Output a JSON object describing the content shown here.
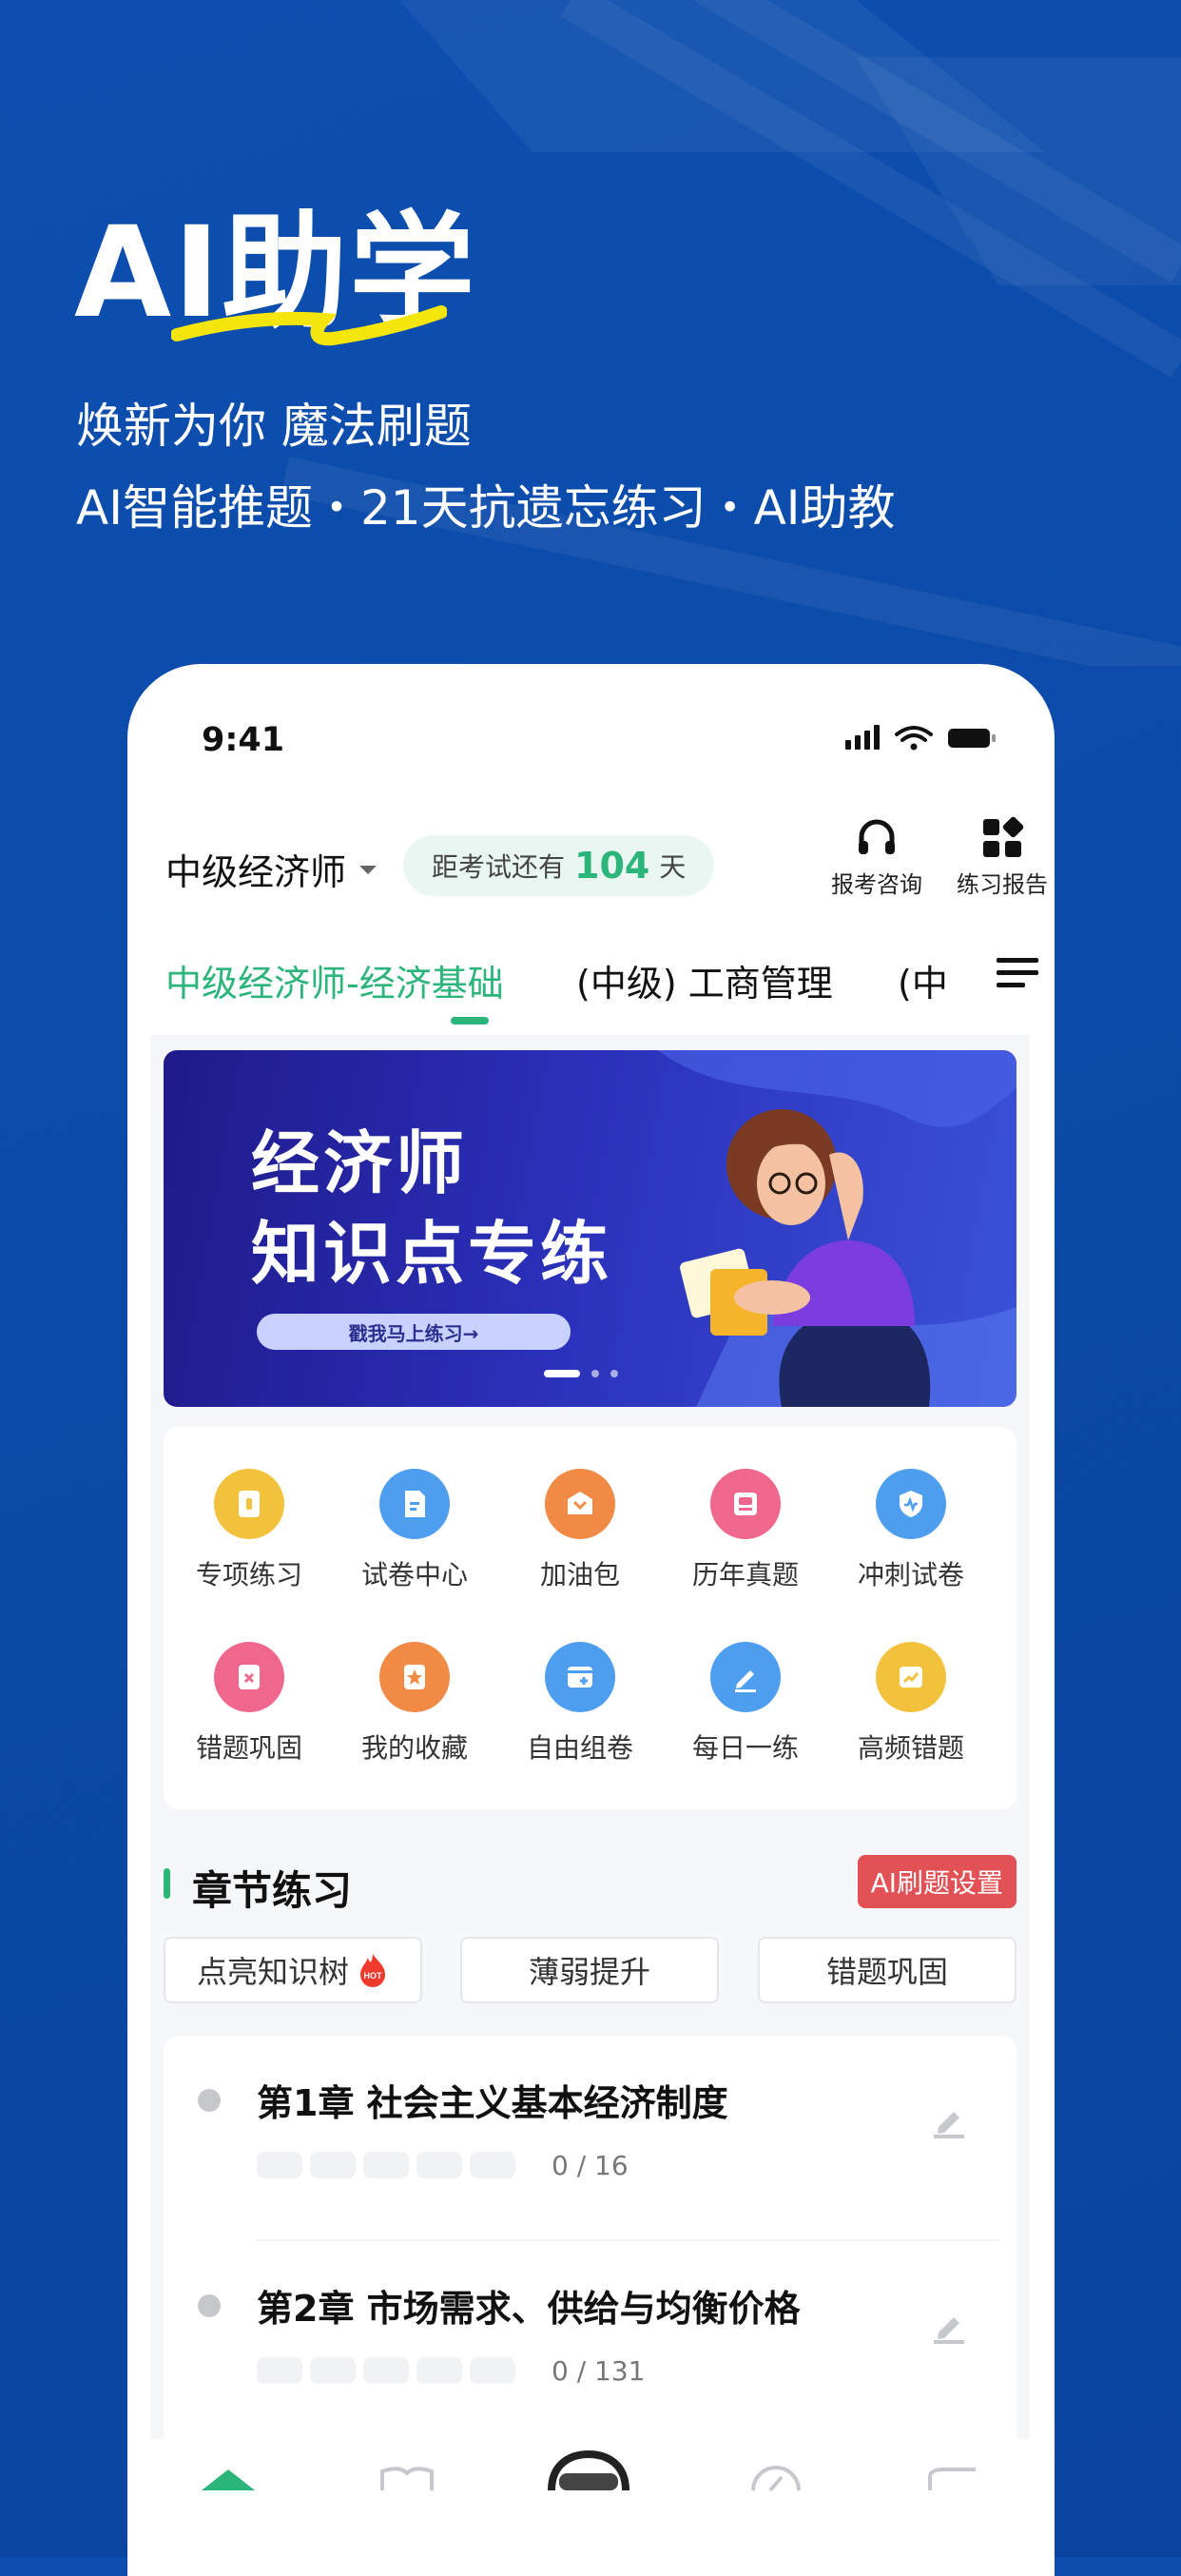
{
  "hero": {
    "title": "AI助学",
    "subtitle": "焕新为你 魔法刷题",
    "features": "AI智能推题・21天抗遗忘练习・AI助教"
  },
  "status_bar": {
    "time": "9:41"
  },
  "header": {
    "exam_name": "中级经济师",
    "countdown_prefix": "距考试还有",
    "countdown_days": "104",
    "countdown_suffix": "天",
    "consult_label": "报考咨询",
    "report_label": "练习报告"
  },
  "tabs": [
    {
      "label": "中级经济师-经济基础",
      "active": true
    },
    {
      "label": "(中级) 工商管理",
      "active": false
    },
    {
      "label": "(中",
      "active": false
    }
  ],
  "banner": {
    "line1": "经济师",
    "line2": "知识点专练",
    "cta": "戳我马上练习→",
    "page_count": 3,
    "current_page": 1
  },
  "features_grid": [
    {
      "label": "专项练习",
      "icon": "practice-icon",
      "color": "#f3c23d"
    },
    {
      "label": "试卷中心",
      "icon": "paper-icon",
      "color": "#4e9ef0"
    },
    {
      "label": "加油包",
      "icon": "gift-icon",
      "color": "#f08a45"
    },
    {
      "label": "历年真题",
      "icon": "history-icon",
      "color": "#f0678e"
    },
    {
      "label": "冲刺试卷",
      "icon": "shield-icon",
      "color": "#4e9ef0"
    },
    {
      "label": "错题巩固",
      "icon": "wrong-icon",
      "color": "#f0678e"
    },
    {
      "label": "我的收藏",
      "icon": "star-icon",
      "color": "#f08a45"
    },
    {
      "label": "自由组卷",
      "icon": "compose-icon",
      "color": "#4e9ef0"
    },
    {
      "label": "每日一练",
      "icon": "pencil-icon",
      "color": "#4e9ef0"
    },
    {
      "label": "高频错题",
      "icon": "trend-icon",
      "color": "#f3c23d"
    }
  ],
  "section": {
    "title": "章节练习",
    "ai_button": "AI刷题设置"
  },
  "filters": [
    {
      "label": "点亮知识树",
      "hot": true,
      "hot_text": "HOT"
    },
    {
      "label": "薄弱提升",
      "hot": false
    },
    {
      "label": "错题巩固",
      "hot": false
    }
  ],
  "chapters": [
    {
      "title": "第1章 社会主义基本经济制度",
      "progress": "0 / 16"
    },
    {
      "title": "第2章 市场需求、供给与均衡价格",
      "progress": "0 / 131"
    }
  ],
  "colors": {
    "background": "#0b4aa8",
    "accent": "#2bb57a",
    "ai_button": "#e25156"
  }
}
